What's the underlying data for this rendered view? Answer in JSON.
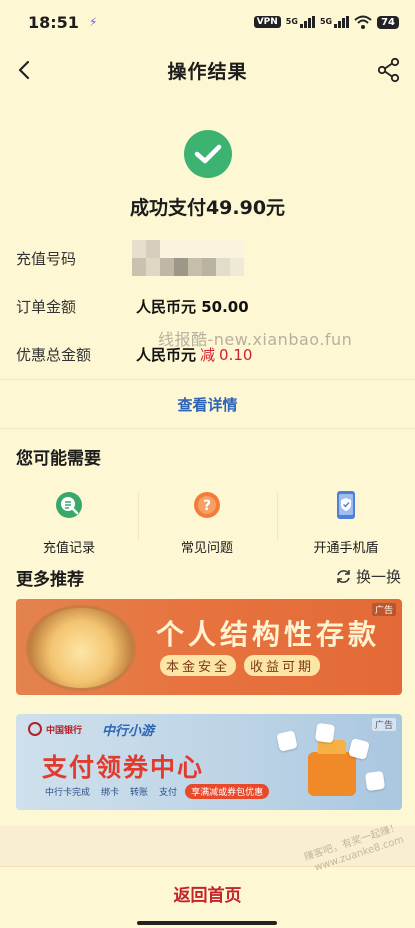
{
  "status_bar": {
    "time": "18:51",
    "vpn": "VPN",
    "network_1": "5G",
    "network_2": "5G",
    "battery": "74"
  },
  "nav": {
    "title": "操作结果"
  },
  "result": {
    "message": "成功支付49.90元",
    "status_color": "#3cb371"
  },
  "info": {
    "recharge_number_label": "充值号码",
    "order_amount_label": "订单金额",
    "order_amount_value": "人民币元 50.00",
    "discount_label": "优惠总金额",
    "discount_value": "人民币元",
    "discount_word": "减",
    "discount_amount": "0.10"
  },
  "watermark": "线报酷-new.xianbao.fun",
  "details_link": "查看详情",
  "maybe_need": {
    "title": "您可能需要",
    "items": [
      {
        "label": "充值记录",
        "icon": "record-icon"
      },
      {
        "label": "常见问题",
        "icon": "question-icon"
      },
      {
        "label": "开通手机盾",
        "icon": "phone-shield-icon"
      }
    ]
  },
  "more": {
    "title": "更多推荐",
    "swap_label": "换一换"
  },
  "banners": {
    "banner1": {
      "ad_tag": "广告",
      "title": "个人结构性存款",
      "sub_1": "本金安全",
      "sub_2": "收益可期"
    },
    "banner2": {
      "ad_tag": "广告",
      "bank_name": "中国银行",
      "brand": "中行小游",
      "title": "支付领券中心",
      "tags": [
        "中行卡完成",
        "绑卡",
        "转账",
        "支付"
      ],
      "pill": "享满减或券包优惠"
    }
  },
  "bottom": {
    "home_button": "返回首页",
    "corner_watermark": "赚客吧，有奖一起赚！ www.zuanke8.com"
  },
  "colors": {
    "background": "#fdf7d3",
    "link_blue": "#2f63b8",
    "accent_red": "#c4232c"
  }
}
